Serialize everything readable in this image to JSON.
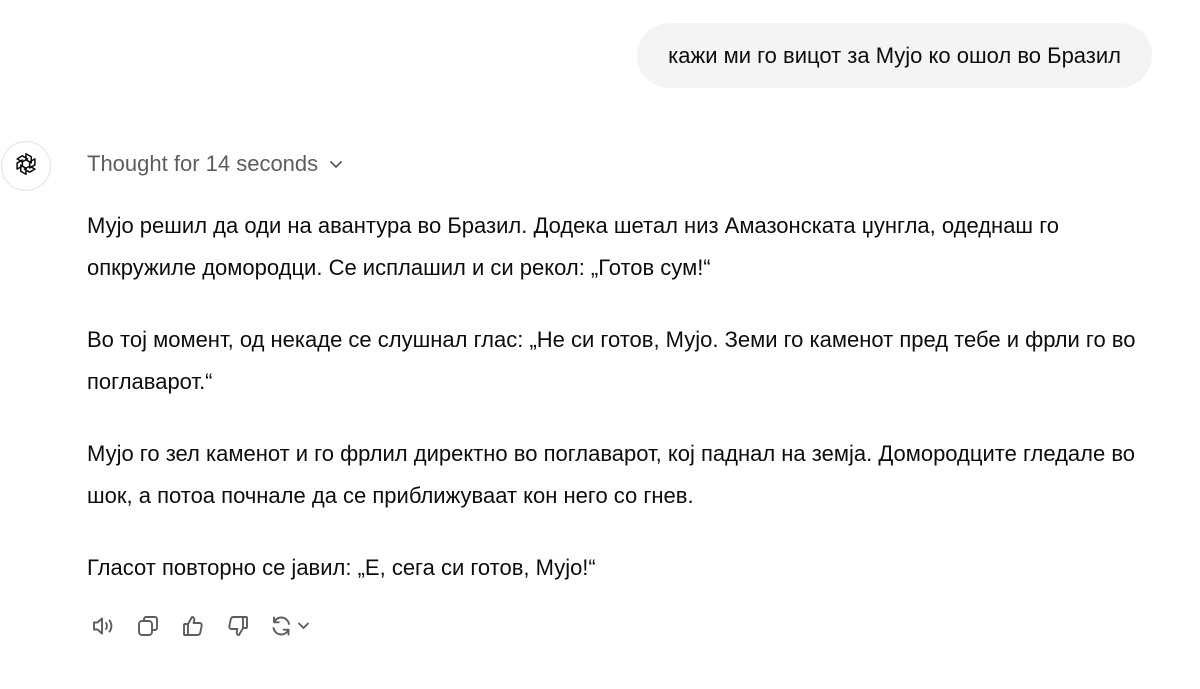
{
  "user_message": {
    "text": "кажи ми го вицот за Мујо ко ошол во Бразил"
  },
  "assistant": {
    "avatar_icon": "openai-logo-icon",
    "thought_label": "Thought for 14 seconds",
    "paragraphs": [
      "Мујо решил да оди на авантура во Бразил. Додека шетал низ Амазонската џунгла, одеднаш го опкружиле домородци. Се исплашил и си рекол: „Готов сум!“",
      "Во тој момент, од некаде се слушнал глас: „Не си готов, Мујо. Земи го каменот пред тебе и фрли го во поглаварот.“",
      "Мујо го зел каменот и го фрлил директно во поглаварот, кој паднал на земја. Домородците гледале во шок, а потоа почнале да се приближуваат кон него со гнев.",
      "Гласот повторно се јавил: „Е, сега си готов, Мујо!“"
    ],
    "actions": [
      {
        "icon": "speaker-icon"
      },
      {
        "icon": "copy-icon"
      },
      {
        "icon": "thumbs-up-icon"
      },
      {
        "icon": "thumbs-down-icon"
      },
      {
        "icon": "regenerate-icon"
      }
    ]
  }
}
